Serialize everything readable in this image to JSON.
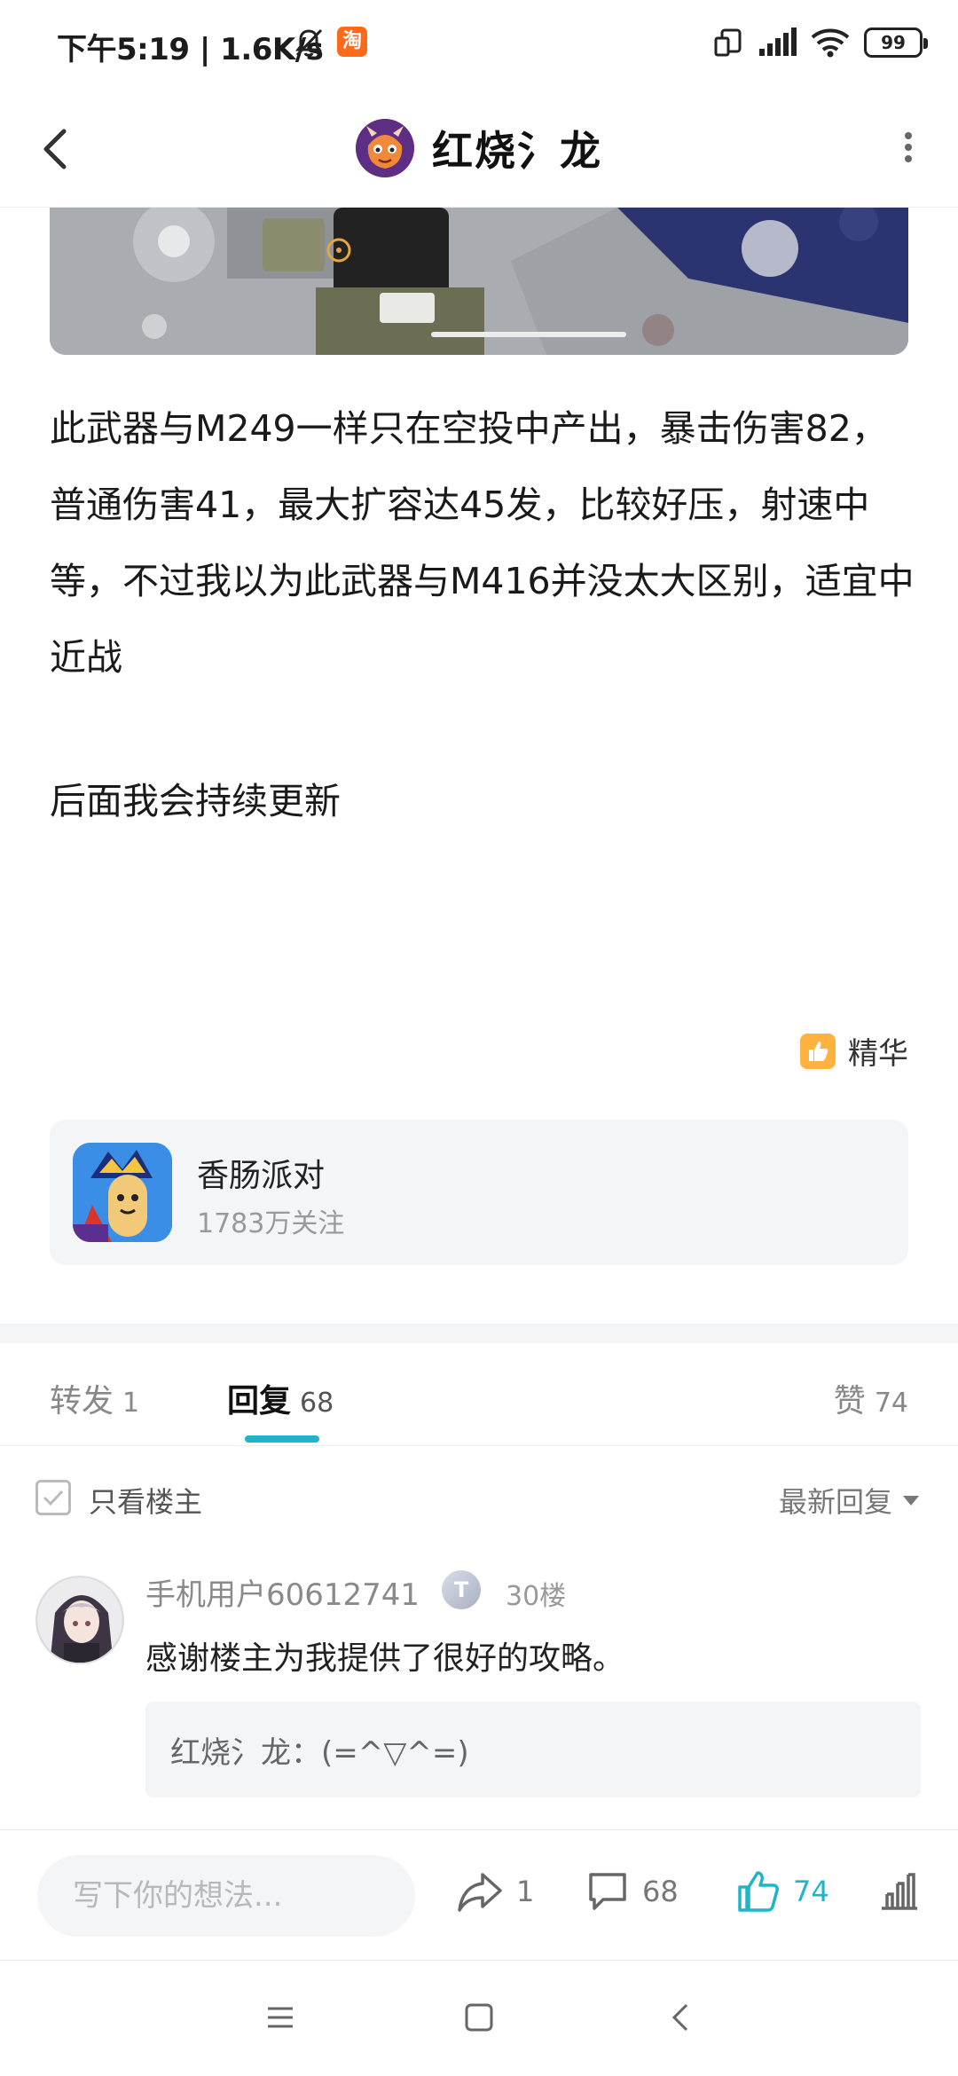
{
  "status_bar": {
    "time_speed": "下午5:19 | 1.6K/s",
    "app_badge": "淘",
    "battery": "99"
  },
  "header": {
    "title": "红烧氵龙"
  },
  "post": {
    "paragraph1": "此武器与M249一样只在空投中产出，暴击伤害82，普通伤害41，最大扩容达45发，比较好压，射速中等，不过我以为此武器与M416并没太大区别，适宜中近战",
    "paragraph2": "后面我会持续更新",
    "essence_label": "精华"
  },
  "forum": {
    "name": "香肠派对",
    "followers": "1783万关注"
  },
  "tabs": [
    {
      "label": "转发",
      "count": "1"
    },
    {
      "label": "回复",
      "count": "68"
    },
    {
      "label": "赞",
      "count": "74"
    }
  ],
  "filter": {
    "only_op": "只看楼主",
    "sort": "最新回复"
  },
  "comment": {
    "user": "手机用户60612741",
    "badge": "T",
    "floor": "30楼",
    "text": "感谢楼主为我提供了很好的攻略。",
    "reply": "红烧氵龙：(=^▽^=)"
  },
  "action_bar": {
    "placeholder": "写下你的想法...",
    "share_count": "1",
    "comment_count": "68",
    "like_count": "74"
  },
  "colors": {
    "accent": "#1fb5c9",
    "essence": "#ffb23f"
  }
}
